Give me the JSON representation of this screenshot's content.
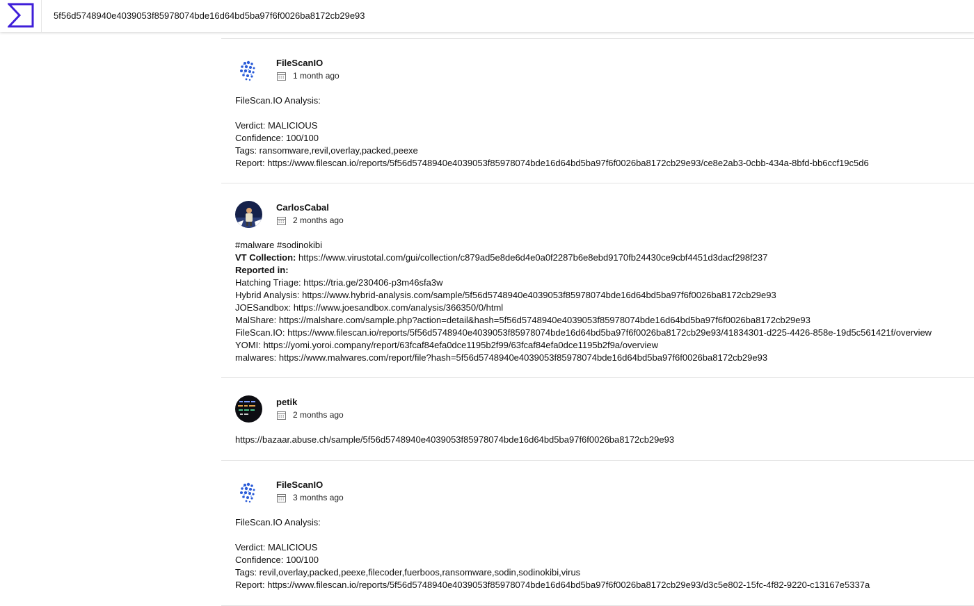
{
  "search": {
    "query": "5f56d5748940e4039053f85978074bde16d64bd5ba97f6f0026ba8172cb29e93"
  },
  "colors": {
    "brand": "#3f1fd9"
  },
  "icons": {
    "logo": "sigma-logo-icon",
    "date": "calendar-icon"
  },
  "comments": [
    {
      "author": "FileScanIO",
      "date": "1 month ago",
      "avatar": "filescan-avatar",
      "lines": [
        "FileScan.IO Analysis:",
        "",
        "Verdict: MALICIOUS",
        "Confidence: 100/100",
        "Tags: ransomware,revil,overlay,packed,peexe",
        "Report: https://www.filescan.io/reports/5f56d5748940e4039053f85978074bde16d64bd5ba97f6f0026ba8172cb29e93/ce8e2ab3-0cbb-434a-8bfd-bb6ccf19c5d6"
      ]
    },
    {
      "author": "CarlosCabal",
      "date": "2 months ago",
      "avatar": "photo-avatar",
      "lines": [
        "#malware #sodinokibi",
        "",
        "",
        "Hatching Triage: https://tria.ge/230406-p3m46sfa3w",
        "Hybrid Analysis: https://www.hybrid-analysis.com/sample/5f56d5748940e4039053f85978074bde16d64bd5ba97f6f0026ba8172cb29e93",
        "JOESandbox: https://www.joesandbox.com/analysis/366350/0/html",
        "MalShare: https://malshare.com/sample.php?action=detail&hash=5f56d5748940e4039053f85978074bde16d64bd5ba97f6f0026ba8172cb29e93",
        "FileScan.IO: https://www.filescan.io/reports/5f56d5748940e4039053f85978074bde16d64bd5ba97f6f0026ba8172cb29e93/41834301-d225-4426-858e-19d5c561421f/overview",
        "YOMI: https://yomi.yoroi.company/report/63fcaf84efa0dce1195b2f99/63fcaf84efa0dce1195b2f9a/overview",
        "malwares: https://www.malwares.com/report/file?hash=5f56d5748940e4039053f85978074bde16d64bd5ba97f6f0026ba8172cb29e93"
      ],
      "vt_label": "VT Collection:",
      "vt_url": " https://www.virustotal.com/gui/collection/c879ad5e8de6d4e0a0f2287b6e8ebd9170fb24430ce9cbf4451d3dacf298f237",
      "reported_label": "Reported in:"
    },
    {
      "author": "petik",
      "date": "2 months ago",
      "avatar": "code-avatar",
      "lines": [
        "https://bazaar.abuse.ch/sample/5f56d5748940e4039053f85978074bde16d64bd5ba97f6f0026ba8172cb29e93"
      ]
    },
    {
      "author": "FileScanIO",
      "date": "3 months ago",
      "avatar": "filescan-avatar",
      "lines": [
        "FileScan.IO Analysis:",
        "",
        "Verdict: MALICIOUS",
        "Confidence: 100/100",
        "Tags: revil,overlay,packed,peexe,filecoder,fuerboos,ransomware,sodin,sodinokibi,virus",
        "Report: https://www.filescan.io/reports/5f56d5748940e4039053f85978074bde16d64bd5ba97f6f0026ba8172cb29e93/d3c5e802-15fc-4f82-9220-c13167e5337a"
      ]
    }
  ]
}
